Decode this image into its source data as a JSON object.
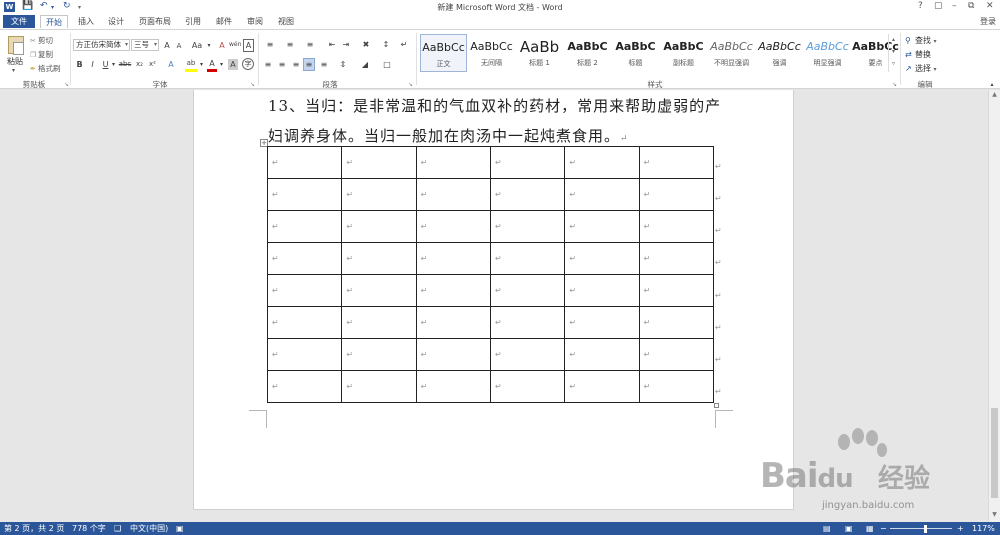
{
  "window": {
    "title": "新建 Microsoft Word 文档 - Word",
    "app_icon_letter": "W",
    "help": "?",
    "login": "登录"
  },
  "tabs": [
    {
      "label": "文件"
    },
    {
      "label": "开始"
    },
    {
      "label": "插入"
    },
    {
      "label": "设计"
    },
    {
      "label": "页面布局"
    },
    {
      "label": "引用"
    },
    {
      "label": "邮件"
    },
    {
      "label": "审阅"
    },
    {
      "label": "视图"
    }
  ],
  "ribbon": {
    "clipboard": {
      "paste": "粘贴",
      "cut": "剪切",
      "copy": "复制",
      "format_painter": "格式刷",
      "group": "剪贴板"
    },
    "font": {
      "name": "方正仿宋简体",
      "size": "三号",
      "grow": "A",
      "shrink": "A",
      "case": "Aa",
      "clear": "A",
      "phonetic": "wén",
      "border_char": "A",
      "bold": "B",
      "italic": "I",
      "underline": "U",
      "strike": "abc",
      "subscript": "x₂",
      "superscript": "x²",
      "text_effect": "A",
      "highlight": "ab",
      "font_color": "A",
      "char_shade": "A",
      "enclose": "字",
      "group": "字体"
    },
    "paragraph": {
      "group": "段落"
    },
    "styles": {
      "group": "样式",
      "items": [
        {
          "sample": "AaBbCc",
          "name": "正文"
        },
        {
          "sample": "AaBbCc",
          "name": "无间隔"
        },
        {
          "sample": "AaBb",
          "name": "标题 1"
        },
        {
          "sample": "AaBbC",
          "name": "标题 2"
        },
        {
          "sample": "AaBbC",
          "name": "标题"
        },
        {
          "sample": "AaBbC",
          "name": "副标题"
        },
        {
          "sample": "AaBbCc",
          "name": "不明显强调"
        },
        {
          "sample": "AaBbCc",
          "name": "强调"
        },
        {
          "sample": "AaBbCc",
          "name": "明显强调"
        },
        {
          "sample": "AaBbCc",
          "name": "要点"
        }
      ]
    },
    "editing": {
      "find": "查找",
      "replace": "替换",
      "select": "选择",
      "group": "编辑"
    }
  },
  "document": {
    "line1": "13、当归：是非常温和的气血双补的药材，常用来帮助虚弱的产",
    "line2": "妇调养身体。当归一般加在肉汤中一起炖煮食用。",
    "para_mark": "↵",
    "table": {
      "rows": 8,
      "cols": 6,
      "cell_mark": "↵"
    }
  },
  "status": {
    "page": "第 2 页，共 2 页",
    "words": "778 个字",
    "language": "中文(中国)",
    "zoom_out": "−",
    "zoom_in": "+",
    "zoom": "117%"
  },
  "watermark": {
    "brand": "Bai",
    "brand2": "du",
    "cn": "经验",
    "url": "jingyan.baidu.com"
  },
  "colors": {
    "accent": "#2b579a",
    "font_color_red": "#d40000",
    "highlight_yellow": "#ffff00"
  }
}
